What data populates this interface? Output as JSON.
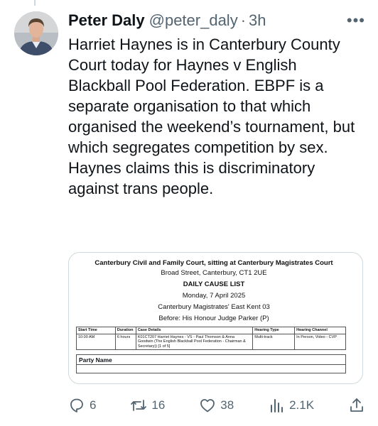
{
  "tweet": {
    "author_name": "Peter Daly",
    "handle": "@peter_daly",
    "separator": "·",
    "time": "3h",
    "more_label": "•••",
    "text": "Harriet Haynes is in Canterbury County Court today for Haynes v English Blackball Pool Federation. EBPF is a separate organisation to that which organised the weekend’s tournament, but which segregates competition by sex. Haynes claims this is discriminatory against trans people."
  },
  "attachment": {
    "court_title": "Canterbury Civil and Family Court, sitting at Canterbury Magistrates Court",
    "address": "Broad Street, Canterbury, CT1 2UE",
    "list_title": "DAILY CAUSE LIST",
    "date": "Monday, 7 April 2025",
    "room": "Canterbury Magistrates' East Kent 03",
    "judge": "Before: His Honour Judge Parker (P)",
    "table": {
      "headers": [
        "Start Time",
        "Duration",
        "Case Details",
        "Hearing Type",
        "Hearing Channel"
      ],
      "row": [
        "10:00 AM",
        "6 hours",
        "K01CT207 Harriet Haynes - VS - Paul Thomson & Anna Goodwin (The English Blackball Pool Federation - Chairman & Secretary)) [1 of 5]",
        "Multi-track",
        "In Person, Video - CVP"
      ]
    },
    "party_header": "Party Name"
  },
  "actions": {
    "replies": "6",
    "reposts": "16",
    "likes": "38",
    "views": "2.1K"
  },
  "icons": {
    "reply": "reply-icon",
    "repost": "repost-icon",
    "like": "heart-icon",
    "views": "views-icon",
    "share": "share-icon"
  },
  "colors": {
    "text": "#0f1419",
    "muted": "#536471",
    "border": "#cfd9de"
  }
}
